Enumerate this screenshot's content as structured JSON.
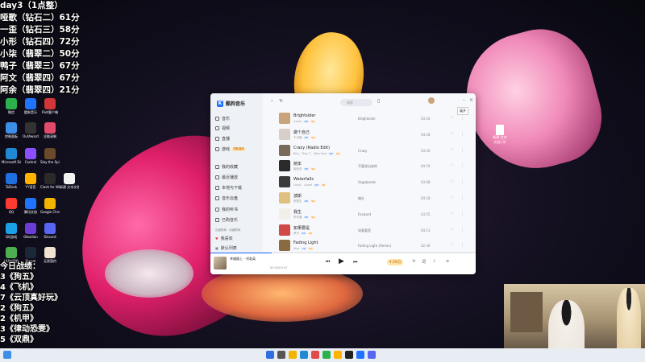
{
  "overlay_lines": [
    "day3（1点整）",
    "哑歌（钻石二）61分",
    "一歪（钻石三）58分",
    "小形（钻石四）72分",
    "小柒（翡翠二）50分",
    "鸭子（翡翠三）67分",
    "阿文（翡翠四）67分",
    "阿余（翡翠四）21分"
  ],
  "results_title": "今日战绩：",
  "results": [
    "3《狗五》",
    "4《飞机》",
    "7《云顶真好玩》",
    "2《狗五》",
    "2《机甲》",
    "3《律动恐雯》",
    "5《双鼎》"
  ],
  "desktop_icons": [
    {
      "label": "微信",
      "color": "#2bb24c"
    },
    {
      "label": "酷狗音乐",
      "color": "#1e73ff"
    },
    {
      "label": "Riot客户端",
      "color": "#d13639"
    },
    {
      "label": "控制面板",
      "color": "#3d8ee6"
    },
    {
      "label": "OutAward",
      "color": "#333333"
    },
    {
      "label": "全能录制",
      "color": "#e24a6a"
    },
    {
      "label": "Microsoft Edge",
      "color": "#1f8ad2"
    },
    {
      "label": "Control",
      "color": "#8a4fff"
    },
    {
      "label": "Slay the Spire 2",
      "color": "#6b4a2a"
    },
    {
      "label": "ToDesk",
      "color": "#1e6fe0"
    },
    {
      "label": "YY语音",
      "color": "#ffb300"
    },
    {
      "label": "Clash for Windows",
      "color": "#2a2a2a"
    },
    {
      "label": "新建 文本文档 (2)",
      "color": "#f2f2f2"
    },
    {
      "label": "QQ",
      "color": "#ff3b30"
    },
    {
      "label": "腾讯文档",
      "color": "#1e73ff"
    },
    {
      "label": "Google Chrome",
      "color": "#f2b400"
    },
    {
      "label": "QQ游戏",
      "color": "#1aa0e6"
    },
    {
      "label": "Obsidian",
      "color": "#6a3dd6"
    },
    {
      "label": "Discord",
      "color": "#5865f2"
    },
    {
      "label": "UU加速器",
      "color": "#4caf50"
    },
    {
      "label": "Steam",
      "color": "#1b2838"
    },
    {
      "label": "无畏契约",
      "color": "#f0e4d0"
    }
  ],
  "app": {
    "name": "酷狗音乐",
    "search_placeholder": "搜索",
    "nav": [
      "音乐",
      "视频",
      "直播",
      "游戏"
    ],
    "promo": "领取福利",
    "nav2": [
      "我的收藏",
      "最近播放",
      "本地与下载",
      "音乐云盘",
      "我的听书",
      "已购音乐"
    ],
    "playlist_header": "自建歌单 · 收藏歌单",
    "playlists": [
      "我喜欢",
      "默认列表"
    ],
    "tooltip": "展开"
  },
  "songs": [
    {
      "title": "Brightsider",
      "artist": "Ceara",
      "album": "Brightsider",
      "duration": "03:16",
      "thumb": "#c9a37a"
    },
    {
      "title": "做个自己",
      "artist": "于贞瑜",
      "album": "",
      "duration": "04:18",
      "thumb": "#d8d0c8"
    },
    {
      "title": "Crazy (Radio Edit)",
      "artist": "Bits、Tony T、Alba Kras",
      "album": "Crazy",
      "duration": "03:20",
      "thumb": "#7a6a5a"
    },
    {
      "title": "她年",
      "artist": "俞晓冬",
      "album": "不要说出来的",
      "duration": "04:19",
      "thumb": "#2a2a2a"
    },
    {
      "title": "Waterfalls",
      "artist": "Lloyd、Lionel",
      "album": "Vagabonds",
      "duration": "03:08",
      "thumb": "#3a3a3a"
    },
    {
      "title": "波斯",
      "artist": "陈楚生",
      "album": "婚礼",
      "duration": "04:18",
      "thumb": "#e0c080"
    },
    {
      "title": "我生",
      "artist": "李宇春",
      "album": "Forward",
      "duration": "03:55",
      "thumb": "#f2efe8"
    },
    {
      "title": "如果要是",
      "artist": "罗贝",
      "album": "如果要是",
      "duration": "04:13",
      "thumb": "#d04848"
    },
    {
      "title": "Fading Light",
      "artist": "Alex",
      "album": "Fading Light (Remix)",
      "duration": "02:39",
      "thumb": "#8a6a40"
    }
  ],
  "player": {
    "title": "幸福路上 - 刘若英",
    "time": "00:53/03:47",
    "vip": "¥ 29/月",
    "progress": 0.23
  },
  "file_label": "新建 文本文档 (3)"
}
